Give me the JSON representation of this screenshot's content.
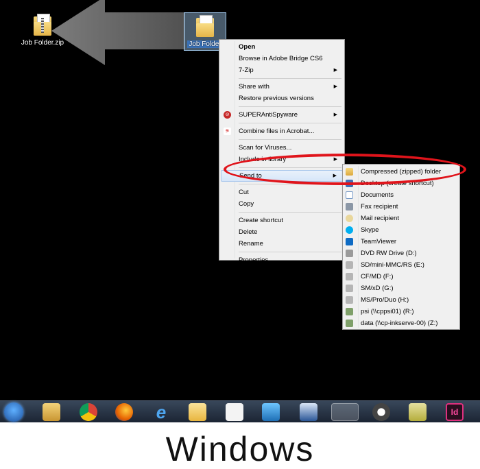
{
  "desktop": {
    "zip_icon_label": "Job Folder.zip",
    "folder_icon_label": "Job Folder"
  },
  "context_menu": {
    "items": [
      {
        "label": "Open",
        "bold": true
      },
      {
        "label": "Browse in Adobe Bridge CS6"
      },
      {
        "label": "7-Zip",
        "submenu": true
      },
      {
        "label": "Share with",
        "submenu": true
      },
      {
        "label": "Restore previous versions"
      },
      {
        "label": "SUPERAntiSpyware",
        "submenu": true
      },
      {
        "label": "Combine files in Acrobat..."
      },
      {
        "label": "Scan for Viruses..."
      },
      {
        "label": "Include in library",
        "submenu": true
      },
      {
        "label": "Send to",
        "submenu": true,
        "highlighted": true
      },
      {
        "label": "Cut"
      },
      {
        "label": "Copy"
      },
      {
        "label": "Create shortcut"
      },
      {
        "label": "Delete"
      },
      {
        "label": "Rename"
      },
      {
        "label": "Properties"
      }
    ]
  },
  "sendto_menu": {
    "items": [
      {
        "label": "Compressed (zipped) folder",
        "icon": "zip-folder-icon"
      },
      {
        "label": "Desktop (create shortcut)",
        "icon": "desktop-icon"
      },
      {
        "label": "Documents",
        "icon": "documents-icon"
      },
      {
        "label": "Fax recipient",
        "icon": "fax-icon"
      },
      {
        "label": "Mail recipient",
        "icon": "mail-icon"
      },
      {
        "label": "Skype",
        "icon": "skype-icon"
      },
      {
        "label": "TeamViewer",
        "icon": "teamviewer-icon"
      },
      {
        "label": "DVD RW Drive (D:)",
        "icon": "dvd-drive-icon"
      },
      {
        "label": "SD/mini-MMC/RS (E:)",
        "icon": "drive-icon"
      },
      {
        "label": "CF/MD (F:)",
        "icon": "drive-icon"
      },
      {
        "label": "SM/xD (G:)",
        "icon": "drive-icon"
      },
      {
        "label": "MS/Pro/Duo (H:)",
        "icon": "drive-icon"
      },
      {
        "label": "psi (\\\\cppsi01) (R:)",
        "icon": "network-drive-icon"
      },
      {
        "label": "data (\\\\cp-inkserve-00) (Z:)",
        "icon": "network-drive-icon"
      }
    ]
  },
  "taskbar": {
    "icons": [
      "start-icon",
      "explorer-icon",
      "chrome-icon",
      "firefox-icon",
      "ie-icon",
      "outlook-icon",
      "acrobat-icon",
      "app-icon",
      "word-icon",
      "excel-icon",
      "xpress-icon",
      "sketchup-icon",
      "indesign-icon"
    ],
    "indesign_label": "Id"
  },
  "caption": "Windows",
  "colors": {
    "highlight_oval": "#e0141b",
    "desktop_bg": "#000000"
  }
}
